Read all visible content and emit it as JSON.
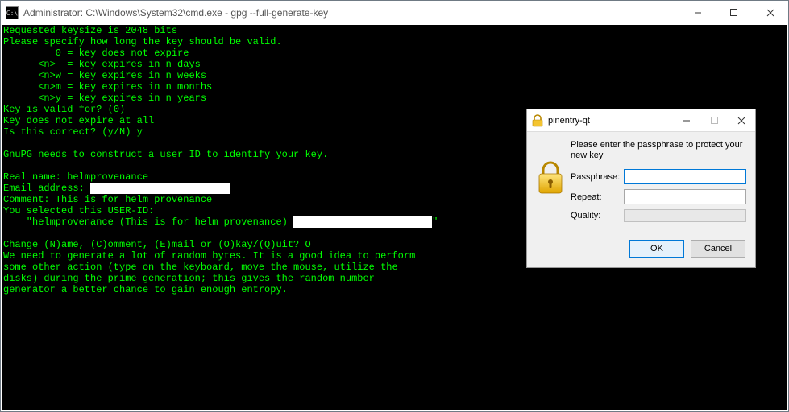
{
  "window": {
    "title": "Administrator: C:\\Windows\\System32\\cmd.exe - gpg  --full-generate-key"
  },
  "terminal": {
    "l0": "Requested keysize is 2048 bits",
    "l1": "Please specify how long the key should be valid.",
    "l2": "         0 = key does not expire",
    "l3": "      <n>  = key expires in n days",
    "l4": "      <n>w = key expires in n weeks",
    "l5": "      <n>m = key expires in n months",
    "l6": "      <n>y = key expires in n years",
    "l7": "Key is valid for? (0)",
    "l8": "Key does not expire at all",
    "l9": "Is this correct? (y/N) y",
    "l10": "",
    "l11": "GnuPG needs to construct a user ID to identify your key.",
    "l12": "",
    "l13": "Real name: helmprovenance",
    "l14a": "Email address: ",
    "l15": "Comment: This is for helm provenance",
    "l16": "You selected this USER-ID:",
    "l17a": "    \"helmprovenance (This is for helm provenance) ",
    "l17b": "\"",
    "l18": "",
    "l19": "Change (N)ame, (C)omment, (E)mail or (O)kay/(Q)uit? O",
    "l20": "We need to generate a lot of random bytes. It is a good idea to perform",
    "l21": "some other action (type on the keyboard, move the mouse, utilize the",
    "l22": "disks) during the prime generation; this gives the random number",
    "l23": "generator a better chance to gain enough entropy."
  },
  "dialog": {
    "title": "pinentry-qt",
    "description": "Please enter the passphrase to protect your new key",
    "labels": {
      "passphrase": "Passphrase:",
      "repeat": "Repeat:",
      "quality": "Quality:"
    },
    "fields": {
      "passphrase": "",
      "repeat": ""
    },
    "buttons": {
      "ok": "OK",
      "cancel": "Cancel"
    }
  }
}
